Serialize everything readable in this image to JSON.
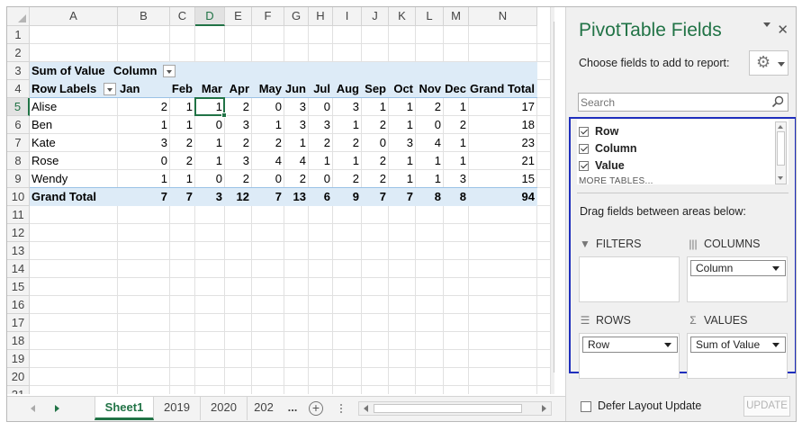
{
  "grid": {
    "columns": [
      "A",
      "B",
      "C",
      "D",
      "E",
      "F",
      "G",
      "H",
      "I",
      "J",
      "K",
      "L",
      "M",
      "N"
    ],
    "active_column": "D",
    "active_row": 5,
    "rows": [
      "1",
      "2",
      "3",
      "4",
      "5",
      "6",
      "7",
      "8",
      "9",
      "10",
      "11",
      "12",
      "13",
      "14",
      "15",
      "16",
      "17",
      "18",
      "19",
      "20",
      "21"
    ]
  },
  "pivot": {
    "sum_label": "Sum of Value",
    "column_label": "Column",
    "row_labels": "Row Labels",
    "months": [
      "Jan",
      "Feb",
      "Mar",
      "Apr",
      "May",
      "Jun",
      "Jul",
      "Aug",
      "Sep",
      "Oct",
      "Nov",
      "Dec"
    ],
    "grand_total_label": "Grand Total",
    "data": [
      {
        "name": "Alise",
        "values": [
          "2",
          "1",
          "1",
          "2",
          "0",
          "3",
          "0",
          "3",
          "1",
          "1",
          "2",
          "1"
        ],
        "total": "17"
      },
      {
        "name": "Ben",
        "values": [
          "1",
          "1",
          "0",
          "3",
          "1",
          "3",
          "3",
          "1",
          "2",
          "1",
          "0",
          "2"
        ],
        "total": "18"
      },
      {
        "name": "Kate",
        "values": [
          "3",
          "2",
          "1",
          "2",
          "2",
          "1",
          "2",
          "2",
          "0",
          "3",
          "4",
          "1"
        ],
        "total": "23"
      },
      {
        "name": "Rose",
        "values": [
          "0",
          "2",
          "1",
          "3",
          "4",
          "4",
          "1",
          "1",
          "2",
          "1",
          "1",
          "1"
        ],
        "total": "21"
      },
      {
        "name": "Wendy",
        "values": [
          "1",
          "1",
          "0",
          "2",
          "0",
          "2",
          "0",
          "2",
          "2",
          "1",
          "1",
          "3"
        ],
        "total": "15"
      }
    ],
    "grand_total": {
      "values": [
        "7",
        "7",
        "3",
        "12",
        "7",
        "13",
        "6",
        "9",
        "7",
        "7",
        "8",
        "8"
      ],
      "total": "94"
    }
  },
  "tabs": {
    "sheets": [
      "Sheet1",
      "2019",
      "2020",
      "202"
    ],
    "more": "..."
  },
  "pane": {
    "title": "PivotTable Fields",
    "choose": "Choose fields to add to report:",
    "search_placeholder": "Search",
    "fields": [
      "Row",
      "Column",
      "Value"
    ],
    "more_tables": "MORE TABLES...",
    "drag_text": "Drag fields between areas below:",
    "areas": {
      "filters": "FILTERS",
      "columns": "COLUMNS",
      "rows": "ROWS",
      "values": "VALUES",
      "columns_item": "Column",
      "rows_item": "Row",
      "values_item": "Sum of Value"
    },
    "defer": "Defer Layout Update",
    "update": "UPDATE",
    "accent": "#217346",
    "highlight": "#1f2fbd"
  }
}
